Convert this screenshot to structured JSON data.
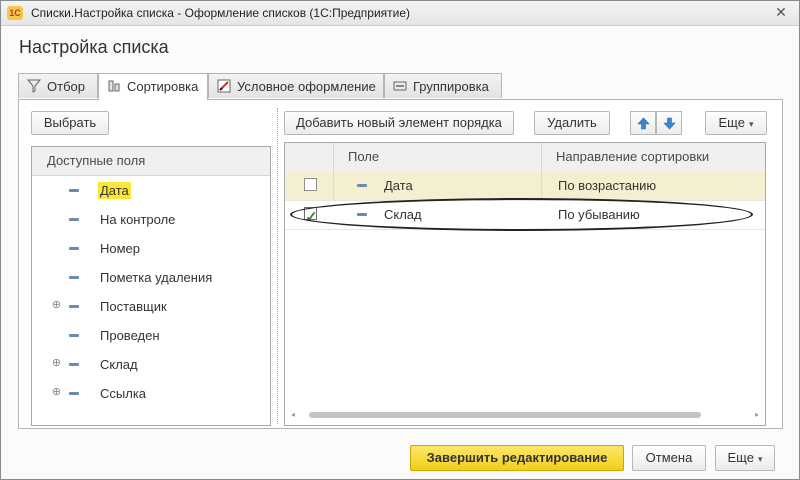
{
  "window": {
    "title": "Списки.Настройка списка - Оформление списков  (1С:Предприятие)",
    "logo_text": "1С"
  },
  "form": {
    "title": "Настройка списка"
  },
  "tabs": [
    {
      "label": "Отбор",
      "icon": "filter-icon"
    },
    {
      "label": "Сортировка",
      "icon": "sort-icon"
    },
    {
      "label": "Условное оформление",
      "icon": "conditional-format-icon"
    },
    {
      "label": "Группировка",
      "icon": "grouping-icon"
    }
  ],
  "active_tab": "Сортировка",
  "left_panel": {
    "select_button": "Выбрать",
    "header": "Доступные поля",
    "fields": [
      {
        "label": "Дата",
        "expandable": false,
        "selected": true
      },
      {
        "label": "На контроле",
        "expandable": false,
        "selected": false
      },
      {
        "label": "Номер",
        "expandable": false,
        "selected": false
      },
      {
        "label": "Пометка удаления",
        "expandable": false,
        "selected": false
      },
      {
        "label": "Поставщик",
        "expandable": true,
        "selected": false
      },
      {
        "label": "Проведен",
        "expandable": false,
        "selected": false
      },
      {
        "label": "Склад",
        "expandable": true,
        "selected": false
      },
      {
        "label": "Ссылка",
        "expandable": true,
        "selected": false
      }
    ]
  },
  "right_panel": {
    "add_button": "Добавить новый элемент порядка",
    "delete_button": "Удалить",
    "more_button": "Еще",
    "columns": {
      "field": "Поле",
      "direction": "Направление сортировки"
    },
    "rows": [
      {
        "checked": false,
        "field": "Дата",
        "direction": "По возрастанию"
      },
      {
        "checked": true,
        "field": "Склад",
        "direction": "По убыванию"
      }
    ]
  },
  "footer": {
    "finish_button": "Завершить редактирование",
    "cancel_button": "Отмена",
    "more_button": "Еще"
  },
  "colors": {
    "accent_yellow": "#f2cf19",
    "selection_yellow": "#fce63a",
    "row_highlight": "#f4efd0",
    "check_green": "#2e8a3a"
  }
}
